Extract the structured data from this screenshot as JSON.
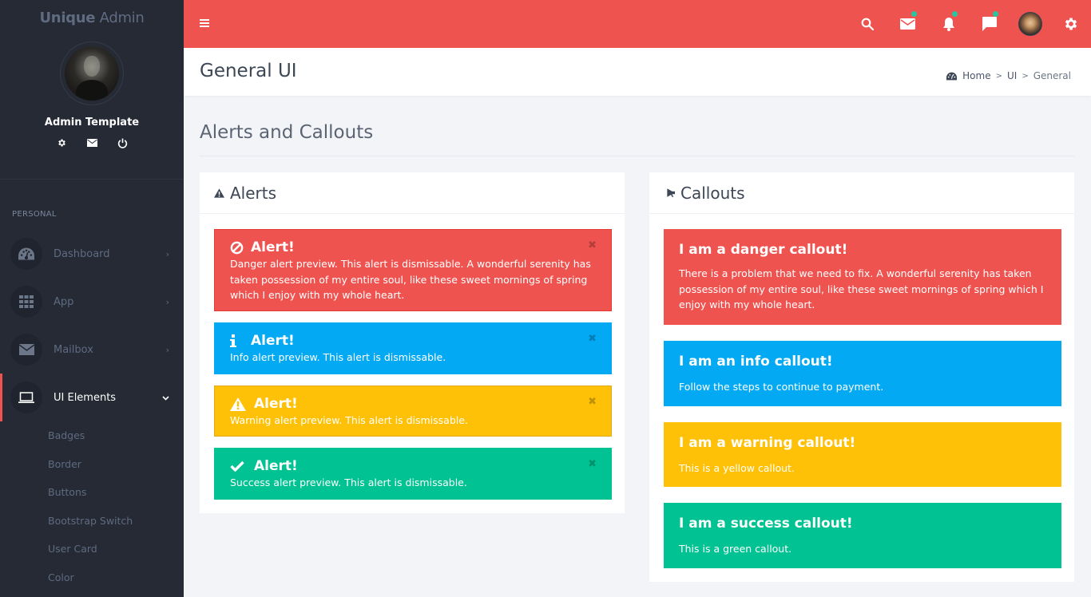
{
  "app": {
    "logo_bold": "Unique",
    "logo_light": " Admin"
  },
  "colors": {
    "primary": "#ef5350",
    "danger": "#ef5350",
    "info": "#03a9f3",
    "warning": "#fec107",
    "success": "#00c292",
    "sidebar_bg": "#252a35",
    "notification_dot": "#26c6a0"
  },
  "sidebar": {
    "profile": {
      "name": "Admin Template",
      "actions": [
        {
          "icon": "gear-icon",
          "label": "Settings"
        },
        {
          "icon": "mail-icon",
          "label": "Mail"
        },
        {
          "icon": "power-icon",
          "label": "Logout"
        }
      ]
    },
    "section_header": "PERSONAL",
    "items": [
      {
        "label": "Dashboard",
        "icon": "dashboard-icon",
        "chevron": "›",
        "active": false
      },
      {
        "label": "App",
        "icon": "grid-icon",
        "chevron": "›",
        "active": false
      },
      {
        "label": "Mailbox",
        "icon": "envelope-icon",
        "chevron": "›",
        "active": false
      },
      {
        "label": "UI Elements",
        "icon": "laptop-icon",
        "chevron": "⌄",
        "active": true
      }
    ],
    "submenu": [
      "Badges",
      "Border",
      "Buttons",
      "Bootstrap Switch",
      "User Card",
      "Color"
    ]
  },
  "topbar": {
    "icons": [
      {
        "name": "search-icon",
        "badge": false
      },
      {
        "name": "mail-icon",
        "badge": true
      },
      {
        "name": "bell-icon",
        "badge": true
      },
      {
        "name": "chat-icon",
        "badge": true
      },
      {
        "name": "user-avatar",
        "badge": false
      },
      {
        "name": "gear-icon",
        "badge": false
      }
    ]
  },
  "page": {
    "title": "General UI",
    "breadcrumb": [
      "Home",
      "UI",
      "General"
    ],
    "breadcrumb_sep": ">"
  },
  "content": {
    "section_title": "Alerts and Callouts",
    "alerts_box": {
      "title": "Alerts",
      "icon": "warning-icon",
      "alerts": [
        {
          "type": "danger",
          "icon": "ban-icon",
          "title": "Alert!",
          "text": "Danger alert preview. This alert is dismissable. A wonderful serenity has taken possession of my entire soul, like these sweet mornings of spring which I enjoy with my whole heart.",
          "close": "✖"
        },
        {
          "type": "info",
          "icon": "info-icon",
          "title": "Alert!",
          "text": "Info alert preview. This alert is dismissable.",
          "close": "✖"
        },
        {
          "type": "warning",
          "icon": "warning-icon",
          "title": "Alert!",
          "text": "Warning alert preview. This alert is dismissable.",
          "close": "✖"
        },
        {
          "type": "success",
          "icon": "check-icon",
          "title": "Alert!",
          "text": "Success alert preview. This alert is dismissable.",
          "close": "✖"
        }
      ]
    },
    "callouts_box": {
      "title": "Callouts",
      "icon": "bullhorn-icon",
      "callouts": [
        {
          "type": "danger",
          "title": "I am a danger callout!",
          "text": "There is a problem that we need to fix. A wonderful serenity has taken possession of my entire soul, like these sweet mornings of spring which I enjoy with my whole heart."
        },
        {
          "type": "info",
          "title": "I am an info callout!",
          "text": "Follow the steps to continue to payment."
        },
        {
          "type": "warning",
          "title": "I am a warning callout!",
          "text": "This is a yellow callout."
        },
        {
          "type": "success",
          "title": "I am a success callout!",
          "text": "This is a green callout."
        }
      ]
    }
  }
}
